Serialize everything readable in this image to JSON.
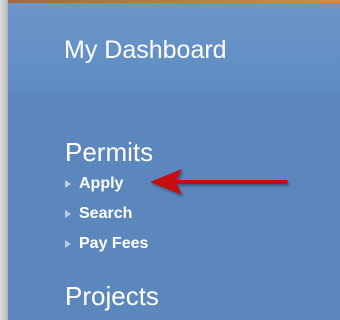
{
  "dashboard": {
    "title": "My Dashboard"
  },
  "sections": [
    {
      "title": "Permits",
      "items": [
        {
          "label": "Apply"
        },
        {
          "label": "Search"
        },
        {
          "label": "Pay Fees"
        }
      ]
    },
    {
      "title": "Projects",
      "items": []
    }
  ],
  "annotation": {
    "arrow_icon": "red-arrow-pointing-left",
    "arrow_color": "#c40d0d"
  },
  "colors": {
    "panel": "#5b87bd",
    "header": "#6390c5",
    "text": "#ffffff",
    "bullet": "#b9cbe2"
  }
}
